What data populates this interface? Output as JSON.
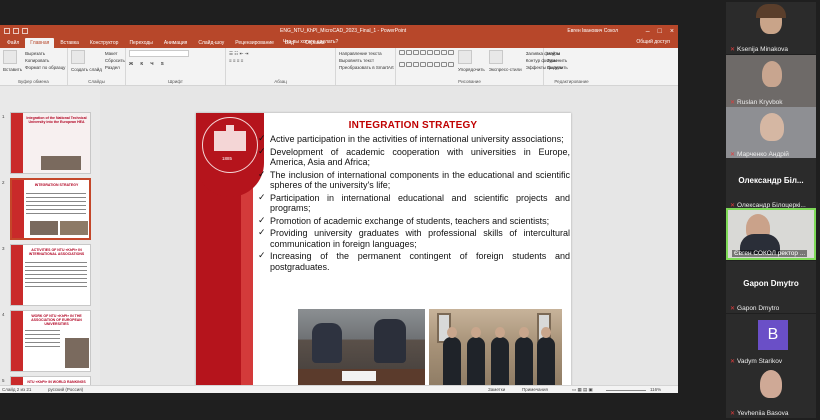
{
  "window": {
    "doc_title": "ENG_NTU_KhPI_MicroCAD_2023_Final_1 - PowerPoint",
    "user": "Евген Іванович Сокол"
  },
  "tabs": [
    "Файл",
    "Главная",
    "Вставка",
    "Конструктор",
    "Переходы",
    "Анимация",
    "Слайд-шоу",
    "Рецензирование",
    "Вид",
    "Справка"
  ],
  "tell_me": "Что вы хотите сделать?",
  "share": "Общий доступ",
  "ribbon": {
    "clipboard": {
      "paste": "Вставить",
      "cut": "Вырезать",
      "copy": "Копировать",
      "format": "Формат по образцу",
      "label": "Буфер обмена"
    },
    "slides": {
      "new": "Создать слайд",
      "layout": "Макет",
      "reset": "Сбросить",
      "section": "Раздел",
      "label": "Слайды"
    },
    "font_label": "Шрифт",
    "paragraph_label": "Абзац",
    "drawing": {
      "direction": "Направление текста",
      "align": "Выровнять текст",
      "smartart": "Преобразовать в SmartArt",
      "label": "Рисование",
      "fill": "Заливка фигуры",
      "outline": "Контур фигуры",
      "effects": "Эффекты фигуры",
      "arrange": "Упорядочить",
      "styles": "Экспресс-стили"
    },
    "editing": {
      "find": "Найти",
      "replace": "Заменить",
      "select": "Выделить",
      "label": "Редактирование"
    }
  },
  "slide": {
    "title": "INTEGRATION STRATEGY",
    "seal_year": "1885",
    "bullets": [
      "Active participation in the activities of international university associations;",
      "Development of academic cooperation with universities in Europe, America, Asia and Africa;",
      "The inclusion of international components in the educational and scientific spheres of the university's life;",
      "Participation in international educational and scientific projects and programs;",
      "Promotion of academic exchange of students, teachers and scientists;",
      "Providing university graduates with professional skills of intercultural communication in foreign languages;",
      "Increasing of the permanent contingent of foreign students and postgraduates."
    ]
  },
  "thumbnails": [
    {
      "num": "1",
      "title": "Integration of the National Technical University into the European HEA"
    },
    {
      "num": "2",
      "title": "INTEGRATION STRATEGY"
    },
    {
      "num": "3",
      "title": "ACTIVITIES OF NTU «KhPI» IN INTERNATIONAL ASSOCIATIONS"
    },
    {
      "num": "4",
      "title": "WORK OF NTU «KhPI» IN THE ASSOCIATION OF EUROPEAN UNIVERSITIES"
    },
    {
      "num": "5",
      "title": "NTU «KhPI» IN WORLD RANKINGS"
    }
  ],
  "status": {
    "slide_count": "Слайд 2 из 21",
    "language": "русский (Россия)",
    "notes": "Заметки",
    "comments": "Примечания",
    "zoom": "116%"
  },
  "participants": [
    {
      "name": "Ksenija Minakova",
      "muted": true
    },
    {
      "name": "Ruslan Kryvbok",
      "muted": true
    },
    {
      "name": "Марченко Андрій",
      "muted": true
    },
    {
      "name": "Олександр Білоцеркі...",
      "display": "Олександр Біл...",
      "muted": true
    },
    {
      "name": "Євген СОКОЛ ректор ...",
      "muted": false
    },
    {
      "name": "Gapon Dmytro",
      "display": "Gapon Dmytro",
      "muted": true
    },
    {
      "name": "Vadym Starikov",
      "avatar": "B",
      "muted": true
    },
    {
      "name": "Yevheniia Basova",
      "muted": true
    }
  ],
  "colors": {
    "ppt_accent": "#b7472a",
    "slide_red": "#b5141c",
    "title_red": "#c00000",
    "active_speaker": "#7ed957"
  }
}
